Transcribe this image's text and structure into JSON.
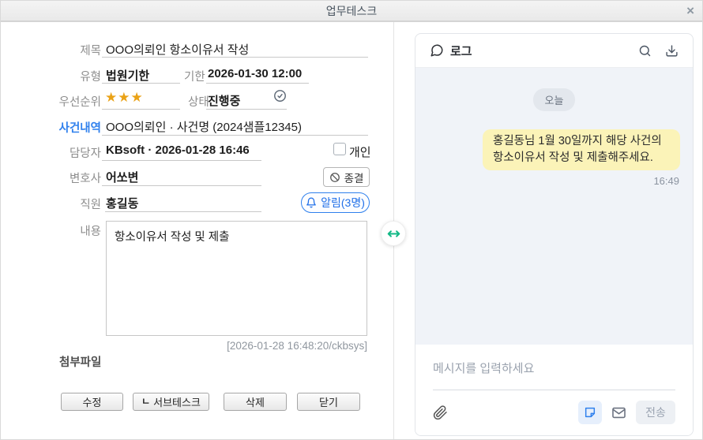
{
  "window": {
    "title": "업무테스크",
    "close_glyph": "×"
  },
  "form": {
    "title": {
      "label": "제목",
      "value": "OOO의뢰인 항소이유서 작성"
    },
    "type": {
      "label": "유형",
      "value": "법원기한"
    },
    "deadline": {
      "label": "기한",
      "value": "2026-01-30 12:00"
    },
    "priority": {
      "label": "우선순위",
      "stars": "★★★"
    },
    "status": {
      "label": "상태",
      "value": "진행중"
    },
    "case": {
      "label": "사건내역",
      "value": "OOO의뢰인 · 사건명 (2024샘플12345)"
    },
    "assignee": {
      "label": "담당자",
      "value": "KBsoft · 2026-01-28 16:46"
    },
    "personal": {
      "label": "개인",
      "checked": false
    },
    "lawyer": {
      "label": "변호사",
      "value": "어쏘변",
      "close_button": "종결"
    },
    "staff": {
      "label": "직원",
      "value": "홍길동",
      "alert_button": "알림(3명)"
    },
    "content": {
      "label": "내용",
      "value": "항소이유서 작성 및 제출"
    },
    "meta_timestamp": "[2026-01-28 16:48:20/ckbsys]",
    "attachments_label": "첨부파일",
    "buttons": {
      "edit": "수정",
      "subtask_prefix": "ㄴ",
      "subtask": "서브테스크",
      "delete": "삭제",
      "close": "닫기"
    }
  },
  "chat": {
    "header_title": "로그",
    "date_badge": "오늘",
    "message": {
      "text": "홍길동님 1월 30일까지 해당 사건의 항소이유서 작성 및 제출해주세요.",
      "time": "16:49"
    },
    "input_placeholder": "메시지를 입력하세요",
    "send_button": "전송"
  },
  "icons": {
    "header": [
      "speech-bubble-icon",
      "search-icon",
      "download-icon"
    ],
    "form": [
      "check-circle-icon",
      "prohibition-icon",
      "bell-icon"
    ],
    "footer": [
      "paperclip-icon",
      "sticky-note-icon",
      "envelope-icon"
    ],
    "divider": "left-right-arrow-icon"
  },
  "colors": {
    "accent_blue": "#2f80ed",
    "star_gold": "#eaa216",
    "bubble_yellow": "#fbf3b8",
    "chat_background": "#f0f3f8",
    "toggle_green": "#12b886"
  }
}
